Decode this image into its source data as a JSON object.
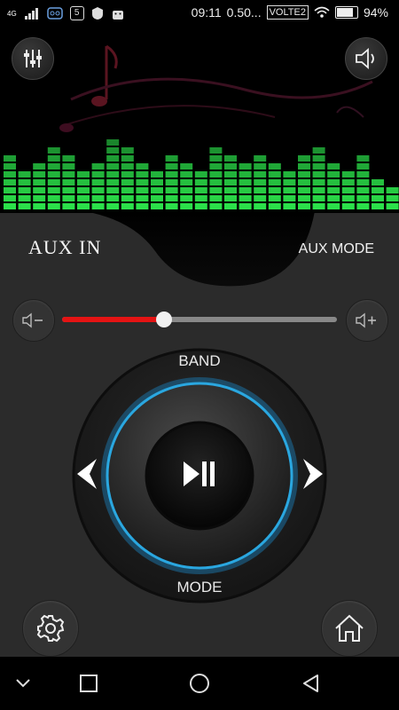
{
  "status_bar": {
    "network": "4G",
    "time": "09:11",
    "speed": "0.50...",
    "volte": "VOLTE2",
    "battery": "94%",
    "battery_level": 0.94,
    "icons": [
      "signal-icon",
      "voicemail-icon",
      "html5-icon",
      "shield-icon",
      "android-icon",
      "wifi-icon",
      "battery-icon"
    ]
  },
  "header": {
    "equalizer_icon": "equalizer-sliders-icon",
    "speaker_icon": "speaker-icon"
  },
  "source": {
    "label": "AUX IN",
    "mode_label": "AUX MODE"
  },
  "volume": {
    "level": 0.37,
    "minus_icon": "volume-down-icon",
    "plus_icon": "volume-up-icon",
    "accent": "#e41414"
  },
  "controller": {
    "band_label": "BAND",
    "mode_label": "MODE",
    "play_icon": "play-pause-icon",
    "prev_icon": "chevron-left-icon",
    "next_icon": "chevron-right-icon",
    "ring_color": "#2aa7e0"
  },
  "footer": {
    "settings_icon": "gear-icon",
    "home_icon": "home-icon"
  },
  "navigation": {
    "items": [
      "collapse-chevron-icon",
      "recents-square-icon",
      "home-circle-icon",
      "back-triangle-icon"
    ]
  },
  "colors": {
    "eq_green": "#2be04a",
    "panel": "#2b2b2b"
  }
}
